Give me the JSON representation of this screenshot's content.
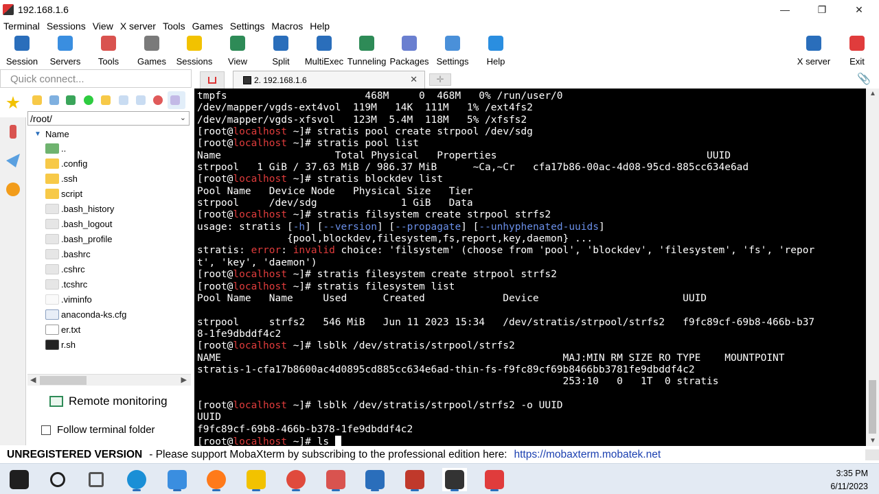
{
  "window": {
    "title": "192.168.1.6"
  },
  "menu": [
    "Terminal",
    "Sessions",
    "View",
    "X server",
    "Tools",
    "Games",
    "Settings",
    "Macros",
    "Help"
  ],
  "toolbar": {
    "items": [
      {
        "label": "Session",
        "icon": "session-icon",
        "color": "#2a6ebb"
      },
      {
        "label": "Servers",
        "icon": "servers-icon",
        "color": "#3a8ee0"
      },
      {
        "label": "Tools",
        "icon": "tools-icon",
        "color": "#d9534f"
      },
      {
        "label": "Games",
        "icon": "games-icon",
        "color": "#7a7a7a"
      },
      {
        "label": "Sessions",
        "icon": "star-icon",
        "color": "#f2c200"
      },
      {
        "label": "View",
        "icon": "view-icon",
        "color": "#2e8b57"
      },
      {
        "label": "Split",
        "icon": "split-icon",
        "color": "#2a6ebb"
      },
      {
        "label": "MultiExec",
        "icon": "multiexec-icon",
        "color": "#2a6ebb"
      },
      {
        "label": "Tunneling",
        "icon": "tunneling-icon",
        "color": "#2e8b57"
      },
      {
        "label": "Packages",
        "icon": "packages-icon",
        "color": "#6a7fd0"
      },
      {
        "label": "Settings",
        "icon": "settings-icon",
        "color": "#4a90d9"
      },
      {
        "label": "Help",
        "icon": "help-icon",
        "color": "#2a8ee0"
      }
    ],
    "xserver": {
      "label": "X server",
      "icon": "xserver-icon",
      "color": "#2a6ebb"
    },
    "exit": {
      "label": "Exit",
      "icon": "power-icon",
      "color": "#e03c3c"
    }
  },
  "sidebar": {
    "quick_connect_placeholder": "Quick connect...",
    "path": "/root/",
    "column_header": "Name",
    "files": [
      {
        "name": "..",
        "type": "up"
      },
      {
        "name": ".config",
        "type": "folder"
      },
      {
        "name": ".ssh",
        "type": "folder"
      },
      {
        "name": "script",
        "type": "folder"
      },
      {
        "name": ".bash_history",
        "type": "file"
      },
      {
        "name": ".bash_logout",
        "type": "file"
      },
      {
        "name": ".bash_profile",
        "type": "file"
      },
      {
        "name": ".bashrc",
        "type": "file"
      },
      {
        "name": ".cshrc",
        "type": "file"
      },
      {
        "name": ".tcshrc",
        "type": "file"
      },
      {
        "name": ".viminfo",
        "type": "vim"
      },
      {
        "name": "anaconda-ks.cfg",
        "type": "cfg"
      },
      {
        "name": "er.txt",
        "type": "txt"
      },
      {
        "name": "r.sh",
        "type": "script"
      }
    ],
    "remote_monitoring": "Remote monitoring",
    "follow_terminal": "Follow terminal folder"
  },
  "tabs": {
    "active_label": "2. 192.168.1.6"
  },
  "terminal": {
    "lines": [
      "tmpfs                       468M     0  468M   0% /run/user/0",
      "/dev/mapper/vgds-ext4vol  119M   14K  111M   1% /ext4fs2",
      "/dev/mapper/vgds-xfsvol   123M  5.4M  118M   5% /xfsfs2",
      "[root@localhost ~]# stratis pool create strpool /dev/sdg",
      "[root@localhost ~]# stratis pool list",
      "Name                   Total Physical   Properties                                   UUID",
      "strpool   1 GiB / 37.63 MiB / 986.37 MiB      ~Ca,~Cr   cfa17b86-00ac-4d08-95cd-885cc634e6ad",
      "[root@localhost ~]# stratis blockdev list",
      "Pool Name   Device Node   Physical Size   Tier",
      "strpool     /dev/sdg              1 GiB   Data",
      "[root@localhost ~]# stratis filsystem create strpool strfs2",
      "usage: stratis [-h] [--version] [--propagate] [--unhyphenated-uuids]",
      "               {pool,blockdev,filesystem,fs,report,key,daemon} ...",
      "stratis: error: invalid choice: 'filsystem' (choose from 'pool', 'blockdev', 'filesystem', 'fs', 'repor",
      "t', 'key', 'daemon')",
      "[root@localhost ~]# stratis filesystem create strpool strfs2",
      "[root@localhost ~]# stratis filesystem list",
      "Pool Name   Name     Used      Created             Device                        UUID",
      "",
      "strpool     strfs2   546 MiB   Jun 11 2023 15:34   /dev/stratis/strpool/strfs2   f9fc89cf-69b8-466b-b37",
      "8-1fe9dbddf4c2",
      "[root@localhost ~]# lsblk /dev/stratis/strpool/strfs2",
      "NAME                                                         MAJ:MIN RM SIZE RO TYPE    MOUNTPOINT",
      "stratis-1-cfa17b8600ac4d0895cd885cc634e6ad-thin-fs-f9fc89cf69b8466bb3781fe9dbddf4c2",
      "                                                             253:10   0   1T  0 stratis",
      "",
      "[root@localhost ~]# lsblk /dev/stratis/strpool/strfs2 -o UUID",
      "UUID",
      "f9fc89cf-69b8-466b-b378-1fe9dbddf4c2",
      "[root@localhost ~]# ls "
    ]
  },
  "status": {
    "unregistered": "UNREGISTERED VERSION",
    "message": "-  Please support MobaXterm by subscribing to the professional edition here:",
    "link": "https://mobaxterm.mobatek.net"
  },
  "taskbar": {
    "apps": [
      {
        "icon": "windows-start-icon",
        "color": "#1f1f1f"
      },
      {
        "icon": "search-icon",
        "color": "#1f1f1f"
      },
      {
        "icon": "task-view-icon",
        "color": "#555555"
      },
      {
        "icon": "edge-icon",
        "color": "#1a8fd6"
      },
      {
        "icon": "control-panel-icon",
        "color": "#3a8ee0"
      },
      {
        "icon": "firefox-icon",
        "color": "#ff7a1a"
      },
      {
        "icon": "file-explorer-icon",
        "color": "#f2c200"
      },
      {
        "icon": "chrome-icon",
        "color": "#e04a3c"
      },
      {
        "icon": "app-icon",
        "color": "#d9534f"
      },
      {
        "icon": "virtualbox-icon",
        "color": "#2a6ebb"
      },
      {
        "icon": "app-icon",
        "color": "#c0392b"
      },
      {
        "icon": "mobaxterm-icon",
        "color": "#333333"
      },
      {
        "icon": "vivaldi-icon",
        "color": "#e03c3c"
      }
    ],
    "time": "3:35 PM",
    "date": "6/11/2023"
  }
}
